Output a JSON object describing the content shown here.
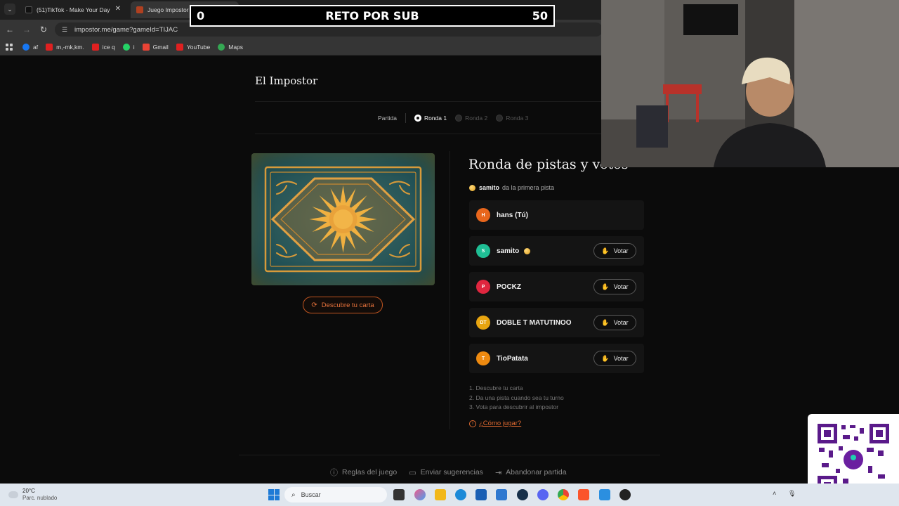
{
  "browser": {
    "tabs": [
      {
        "title": "(51)TikTok - Make Your Day",
        "active": false
      },
      {
        "title": "Juego Impostor Online Gratis -",
        "active": true
      }
    ],
    "url": "impostor.me/game?gameId=TIJAC",
    "bookmarks": [
      "af",
      "m,-mk,km.",
      "ice q",
      "i",
      "Gmail",
      "YouTube",
      "Maps"
    ]
  },
  "overlay": {
    "left": "0",
    "center": "RETO POR SUB",
    "right": "50"
  },
  "site": {
    "title": "El Impostor"
  },
  "stepper": {
    "label": "Partida",
    "rounds": [
      {
        "label": "Ronda 1",
        "active": true
      },
      {
        "label": "Ronda 2",
        "active": false
      },
      {
        "label": "Ronda 3",
        "active": false
      }
    ]
  },
  "card": {
    "reveal_label": "Descubre tu carta"
  },
  "round": {
    "title": "Ronda de pistas y votos",
    "first_clue_player": "samito",
    "first_clue_text": "da la primera pista"
  },
  "players": [
    {
      "initials": "H",
      "name": "hans (Tú)",
      "color": "#e8661c",
      "can_vote": false,
      "first": false
    },
    {
      "initials": "S",
      "name": "samito",
      "color": "#1fbf95",
      "can_vote": true,
      "first": true
    },
    {
      "initials": "P",
      "name": "POCKZ",
      "color": "#e0263f",
      "can_vote": true,
      "first": false
    },
    {
      "initials": "DT",
      "name": "DOBLE T MATUTINOO",
      "color": "#e8a510",
      "can_vote": true,
      "first": false
    },
    {
      "initials": "T",
      "name": "TioPatata",
      "color": "#ee8a10",
      "can_vote": true,
      "first": false
    }
  ],
  "vote_label": "Votar",
  "instructions": [
    "1. Descubre tu carta",
    "2. Da una pista cuando sea tu turno",
    "3. Vota para descubrir al impostor"
  ],
  "howto_label": "¿Cómo jugar?",
  "footer": {
    "rules": "Reglas del juego",
    "suggest": "Enviar sugerencias",
    "leave": "Abandonar partida"
  },
  "taskbar": {
    "temp": "20°C",
    "weather": "Parc. nublado",
    "search_placeholder": "Buscar"
  },
  "colors": {
    "accent": "#e06a30",
    "background": "#0b0b0b",
    "panel": "#141414"
  }
}
